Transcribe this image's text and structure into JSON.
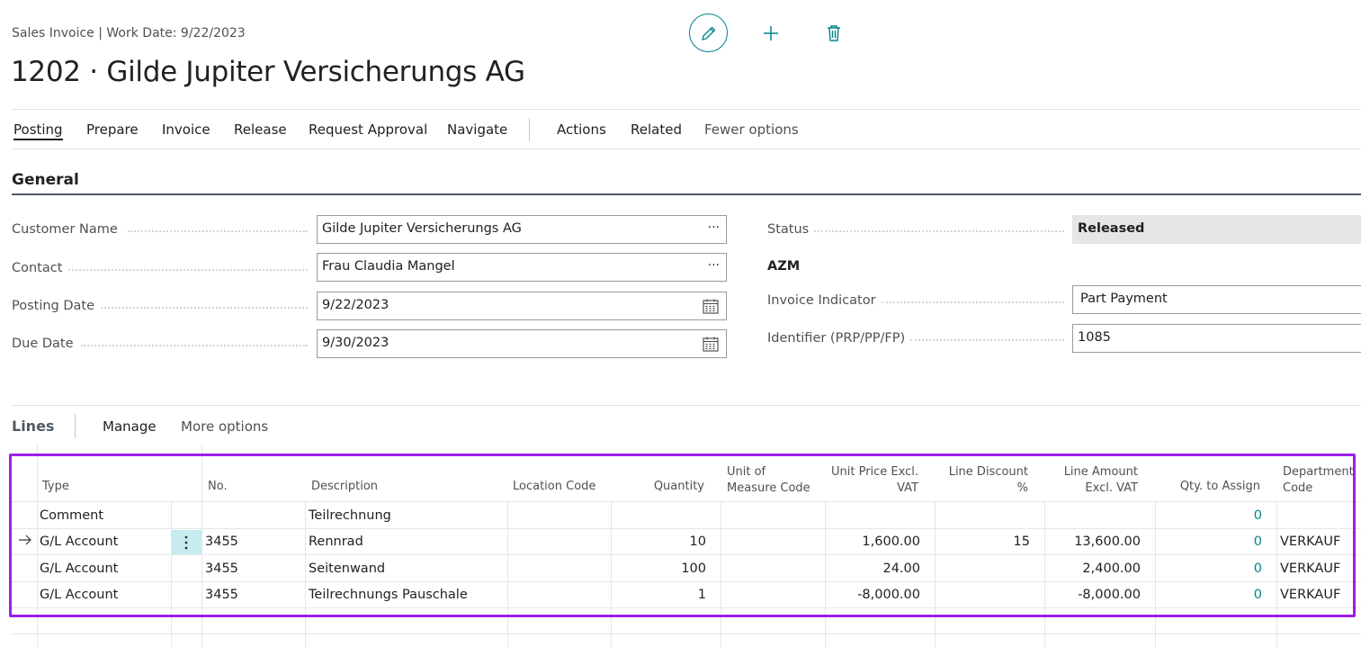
{
  "header": {
    "breadcrumb": "Sales Invoice | Work Date: 9/22/2023",
    "title": "1202 · Gilde Jupiter Versicherungs AG",
    "icons": [
      "pencil-icon",
      "plus-icon",
      "trash-icon"
    ]
  },
  "actions": {
    "items": [
      "Posting",
      "Prepare",
      "Invoice",
      "Release",
      "Request Approval",
      "Navigate",
      "Actions",
      "Related",
      "Fewer options"
    ]
  },
  "general": {
    "title": "General",
    "customer_name": {
      "label": "Customer Name",
      "value": "Gilde Jupiter Versicherungs AG",
      "button": "···"
    },
    "contact": {
      "label": "Contact",
      "value": "Frau Claudia Mangel",
      "button": "···"
    },
    "posting_date": {
      "label": "Posting Date",
      "value": "9/22/2023"
    },
    "due_date": {
      "label": "Due Date",
      "value": "9/30/2023"
    },
    "status": {
      "label": "Status",
      "value": "Released"
    },
    "azm_heading": "AZM",
    "invoice_indicator": {
      "label": "Invoice Indicator",
      "value": "Part Payment"
    },
    "identifier": {
      "label": "Identifier (PRP/PP/FP)",
      "value": "1085"
    }
  },
  "lines": {
    "title": "Lines",
    "manage": "Manage",
    "more_options": "More options",
    "headers": {
      "type": "Type",
      "no": "No.",
      "description": "Description",
      "location": "Location Code",
      "quantity": "Quantity",
      "uom_1": "Unit of",
      "uom_2": "Measure Code",
      "unit_price_1": "Unit Price Excl.",
      "unit_price_2": "VAT",
      "discount_1": "Line Discount",
      "discount_2": "%",
      "amount_1": "Line Amount",
      "amount_2": "Excl. VAT",
      "qty_assign": "Qty. to Assign",
      "dept_1": "Department",
      "dept_2": "Code"
    },
    "rows": [
      {
        "type": "Comment",
        "no": "",
        "description": "Teilrechnung",
        "quantity": "",
        "unit_price": "",
        "discount": "",
        "amount": "",
        "qty_assign": "0",
        "dept": ""
      },
      {
        "type": "G/L Account",
        "no": "3455",
        "description": "Rennrad",
        "quantity": "10",
        "unit_price": "1,600.00",
        "discount": "15",
        "amount": "13,600.00",
        "qty_assign": "0",
        "dept": "VERKAUF"
      },
      {
        "type": "G/L Account",
        "no": "3455",
        "description": "Seitenwand",
        "quantity": "100",
        "unit_price": "24.00",
        "discount": "",
        "amount": "2,400.00",
        "qty_assign": "0",
        "dept": "VERKAUF"
      },
      {
        "type": "G/L Account",
        "no": "3455",
        "description": "Teilrechnungs Pauschale",
        "quantity": "1",
        "unit_price": "-8,000.00",
        "discount": "",
        "amount": "-8,000.00",
        "qty_assign": "0",
        "dept": "VERKAUF"
      }
    ]
  },
  "colors": {
    "accent": "#008489",
    "highlight": "#9b1fe8",
    "status_bg": "#e6e6e6"
  }
}
